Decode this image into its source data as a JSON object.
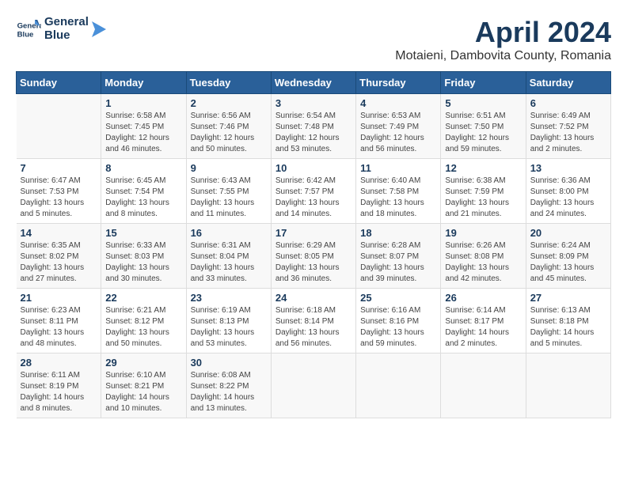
{
  "header": {
    "logo_line1": "General",
    "logo_line2": "Blue",
    "month_year": "April 2024",
    "location": "Motaieni, Dambovita County, Romania"
  },
  "days_of_week": [
    "Sunday",
    "Monday",
    "Tuesday",
    "Wednesday",
    "Thursday",
    "Friday",
    "Saturday"
  ],
  "weeks": [
    [
      {
        "day": "",
        "content": ""
      },
      {
        "day": "1",
        "content": "Sunrise: 6:58 AM\nSunset: 7:45 PM\nDaylight: 12 hours\nand 46 minutes."
      },
      {
        "day": "2",
        "content": "Sunrise: 6:56 AM\nSunset: 7:46 PM\nDaylight: 12 hours\nand 50 minutes."
      },
      {
        "day": "3",
        "content": "Sunrise: 6:54 AM\nSunset: 7:48 PM\nDaylight: 12 hours\nand 53 minutes."
      },
      {
        "day": "4",
        "content": "Sunrise: 6:53 AM\nSunset: 7:49 PM\nDaylight: 12 hours\nand 56 minutes."
      },
      {
        "day": "5",
        "content": "Sunrise: 6:51 AM\nSunset: 7:50 PM\nDaylight: 12 hours\nand 59 minutes."
      },
      {
        "day": "6",
        "content": "Sunrise: 6:49 AM\nSunset: 7:52 PM\nDaylight: 13 hours\nand 2 minutes."
      }
    ],
    [
      {
        "day": "7",
        "content": "Sunrise: 6:47 AM\nSunset: 7:53 PM\nDaylight: 13 hours\nand 5 minutes."
      },
      {
        "day": "8",
        "content": "Sunrise: 6:45 AM\nSunset: 7:54 PM\nDaylight: 13 hours\nand 8 minutes."
      },
      {
        "day": "9",
        "content": "Sunrise: 6:43 AM\nSunset: 7:55 PM\nDaylight: 13 hours\nand 11 minutes."
      },
      {
        "day": "10",
        "content": "Sunrise: 6:42 AM\nSunset: 7:57 PM\nDaylight: 13 hours\nand 14 minutes."
      },
      {
        "day": "11",
        "content": "Sunrise: 6:40 AM\nSunset: 7:58 PM\nDaylight: 13 hours\nand 18 minutes."
      },
      {
        "day": "12",
        "content": "Sunrise: 6:38 AM\nSunset: 7:59 PM\nDaylight: 13 hours\nand 21 minutes."
      },
      {
        "day": "13",
        "content": "Sunrise: 6:36 AM\nSunset: 8:00 PM\nDaylight: 13 hours\nand 24 minutes."
      }
    ],
    [
      {
        "day": "14",
        "content": "Sunrise: 6:35 AM\nSunset: 8:02 PM\nDaylight: 13 hours\nand 27 minutes."
      },
      {
        "day": "15",
        "content": "Sunrise: 6:33 AM\nSunset: 8:03 PM\nDaylight: 13 hours\nand 30 minutes."
      },
      {
        "day": "16",
        "content": "Sunrise: 6:31 AM\nSunset: 8:04 PM\nDaylight: 13 hours\nand 33 minutes."
      },
      {
        "day": "17",
        "content": "Sunrise: 6:29 AM\nSunset: 8:05 PM\nDaylight: 13 hours\nand 36 minutes."
      },
      {
        "day": "18",
        "content": "Sunrise: 6:28 AM\nSunset: 8:07 PM\nDaylight: 13 hours\nand 39 minutes."
      },
      {
        "day": "19",
        "content": "Sunrise: 6:26 AM\nSunset: 8:08 PM\nDaylight: 13 hours\nand 42 minutes."
      },
      {
        "day": "20",
        "content": "Sunrise: 6:24 AM\nSunset: 8:09 PM\nDaylight: 13 hours\nand 45 minutes."
      }
    ],
    [
      {
        "day": "21",
        "content": "Sunrise: 6:23 AM\nSunset: 8:11 PM\nDaylight: 13 hours\nand 48 minutes."
      },
      {
        "day": "22",
        "content": "Sunrise: 6:21 AM\nSunset: 8:12 PM\nDaylight: 13 hours\nand 50 minutes."
      },
      {
        "day": "23",
        "content": "Sunrise: 6:19 AM\nSunset: 8:13 PM\nDaylight: 13 hours\nand 53 minutes."
      },
      {
        "day": "24",
        "content": "Sunrise: 6:18 AM\nSunset: 8:14 PM\nDaylight: 13 hours\nand 56 minutes."
      },
      {
        "day": "25",
        "content": "Sunrise: 6:16 AM\nSunset: 8:16 PM\nDaylight: 13 hours\nand 59 minutes."
      },
      {
        "day": "26",
        "content": "Sunrise: 6:14 AM\nSunset: 8:17 PM\nDaylight: 14 hours\nand 2 minutes."
      },
      {
        "day": "27",
        "content": "Sunrise: 6:13 AM\nSunset: 8:18 PM\nDaylight: 14 hours\nand 5 minutes."
      }
    ],
    [
      {
        "day": "28",
        "content": "Sunrise: 6:11 AM\nSunset: 8:19 PM\nDaylight: 14 hours\nand 8 minutes."
      },
      {
        "day": "29",
        "content": "Sunrise: 6:10 AM\nSunset: 8:21 PM\nDaylight: 14 hours\nand 10 minutes."
      },
      {
        "day": "30",
        "content": "Sunrise: 6:08 AM\nSunset: 8:22 PM\nDaylight: 14 hours\nand 13 minutes."
      },
      {
        "day": "",
        "content": ""
      },
      {
        "day": "",
        "content": ""
      },
      {
        "day": "",
        "content": ""
      },
      {
        "day": "",
        "content": ""
      }
    ]
  ]
}
